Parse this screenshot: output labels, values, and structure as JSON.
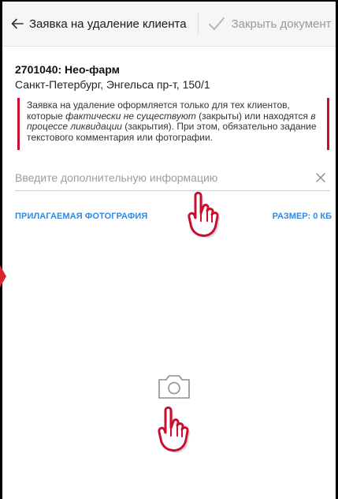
{
  "toolbar": {
    "back_icon": "arrow-left-icon",
    "title": "Заявка на удаление клиента",
    "close_icon": "checkmark-icon",
    "close_label": "Закрыть документ"
  },
  "client": {
    "code_name": "2701040: Нео-фарм",
    "address": "Санкт-Петербург, Энгельса пр-т, 150/1"
  },
  "notice": {
    "part1": "Заявка на удаление оформляется только для тех клиентов, которые ",
    "em1": "фактически не существуют",
    "part2": " (закрыты) или находятся ",
    "em2": "в процессе ликвидации",
    "part3": " (закрытия). При этом, обязательно задание текстового комментария или фотографии."
  },
  "info_input": {
    "value": "",
    "placeholder": "Введите дополнительную информацию",
    "clear_icon": "close-icon"
  },
  "photo": {
    "label": "ПРИЛАГАЕМАЯ ФОТОГРАФИЯ",
    "size_label": "РАЗМЕР: 0 КБ",
    "camera_icon": "camera-icon"
  },
  "colors": {
    "accent_red": "#c8102e",
    "link_blue": "#2f8ae0"
  }
}
